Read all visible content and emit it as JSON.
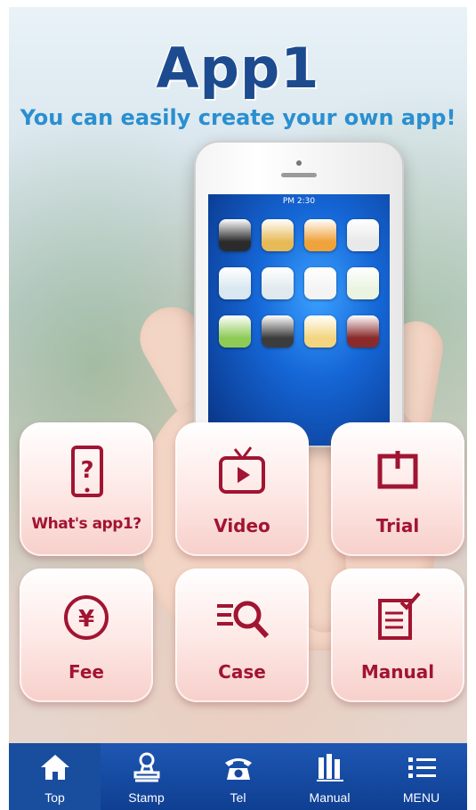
{
  "header": {
    "logo_text": "App1",
    "tagline": "You can easily create your own app!"
  },
  "phone": {
    "status_time": "PM 2:30",
    "app_icon_colors": [
      "#2b2b2b",
      "#e7ba57",
      "#f0a23b",
      "#e9e9e9",
      "#d9e7f0",
      "#dfe9ee",
      "#f4f4f4",
      "#eaf4e0",
      "#8ecb56",
      "#3c3c3c",
      "#f3d580",
      "#8a2a2a"
    ]
  },
  "tiles": [
    {
      "label": "What's app1?",
      "icon": "tablet-question-icon"
    },
    {
      "label": "Video",
      "icon": "tv-play-icon"
    },
    {
      "label": "Trial",
      "icon": "trial-box-icon"
    },
    {
      "label": "Fee",
      "icon": "yen-circle-icon"
    },
    {
      "label": "Case",
      "icon": "search-list-icon"
    },
    {
      "label": "Manual",
      "icon": "checklist-icon"
    }
  ],
  "tabbar": {
    "items": [
      {
        "label": "Top",
        "icon": "home-icon",
        "active": true
      },
      {
        "label": "Stamp",
        "icon": "stamp-icon",
        "active": false
      },
      {
        "label": "Tel",
        "icon": "phone-icon",
        "active": false
      },
      {
        "label": "Manual",
        "icon": "books-icon",
        "active": false
      },
      {
        "label": "MENU",
        "icon": "menu-list-icon",
        "active": false
      }
    ]
  },
  "colors": {
    "brand_blue": "#1d4b8f",
    "tagline_blue": "#2a8fd0",
    "tile_accent": "#a11432",
    "tabbar_blue": "#1e57b3"
  }
}
